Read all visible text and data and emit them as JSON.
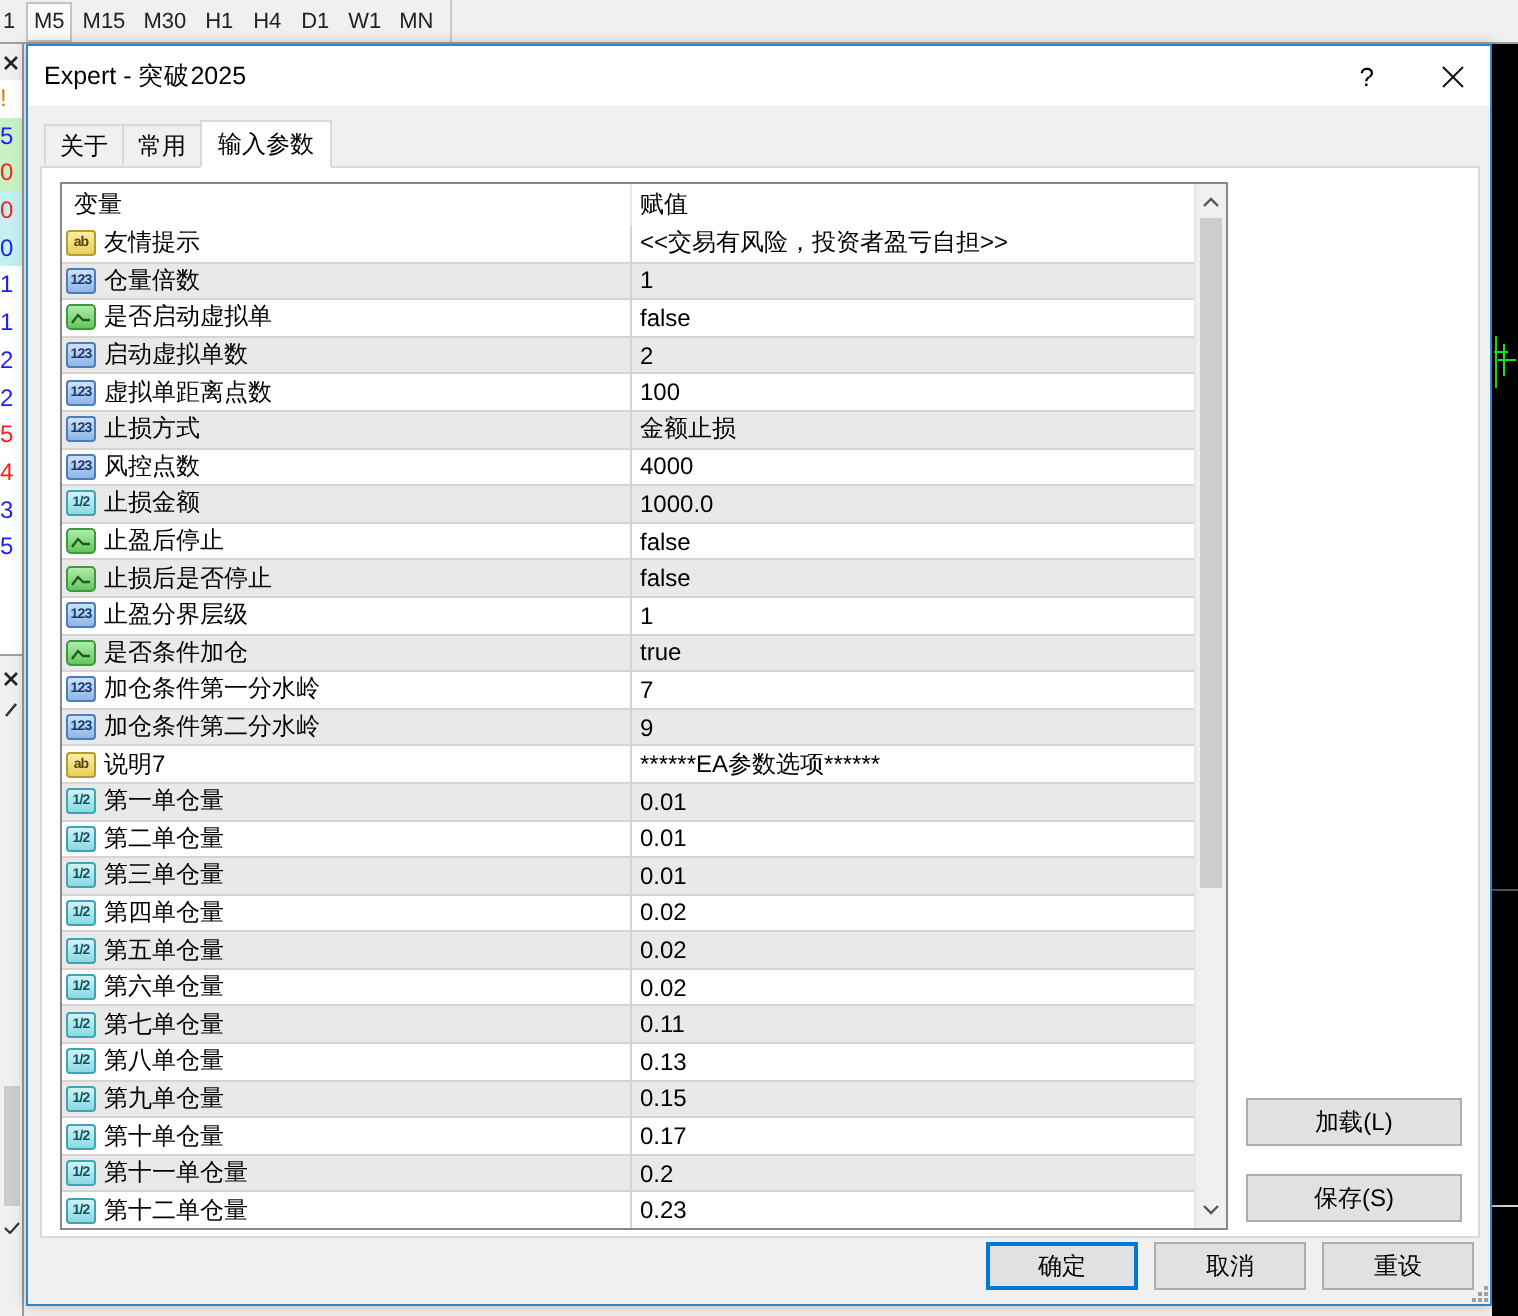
{
  "toolbar": {
    "timeframes": [
      {
        "label": "1",
        "selected": false
      },
      {
        "label": "M5",
        "selected": true
      },
      {
        "label": "M15",
        "selected": false
      },
      {
        "label": "M30",
        "selected": false
      },
      {
        "label": "H1",
        "selected": false
      },
      {
        "label": "H4",
        "selected": false
      },
      {
        "label": "D1",
        "selected": false
      },
      {
        "label": "W1",
        "selected": false
      },
      {
        "label": "MN",
        "selected": false
      }
    ]
  },
  "market_watch": [
    {
      "text": "!",
      "color": "#e07b00",
      "kind": "plain"
    },
    {
      "text": "5",
      "color": "#1c1cff",
      "kind": "green"
    },
    {
      "text": "0",
      "color": "#ff1c1c",
      "kind": "green"
    },
    {
      "text": "0",
      "color": "#ff1c1c",
      "kind": "cyan"
    },
    {
      "text": "0",
      "color": "#1c1cff",
      "kind": "cyan"
    },
    {
      "text": "1",
      "color": "#1c1cff",
      "kind": "plain"
    },
    {
      "text": "1",
      "color": "#1c1cff",
      "kind": "plain"
    },
    {
      "text": "2",
      "color": "#1c1cff",
      "kind": "plain"
    },
    {
      "text": "2",
      "color": "#1c1cff",
      "kind": "plain"
    },
    {
      "text": "5",
      "color": "#ff1c1c",
      "kind": "plain"
    },
    {
      "text": "4",
      "color": "#ff1c1c",
      "kind": "plain"
    },
    {
      "text": "3",
      "color": "#1c1cff",
      "kind": "plain"
    },
    {
      "text": "5",
      "color": "#1c1cff",
      "kind": "plain"
    }
  ],
  "dialog": {
    "title": "Expert - 突破2025",
    "help": "?",
    "tabs": [
      {
        "label": "关于",
        "selected": false
      },
      {
        "label": "常用",
        "selected": false
      },
      {
        "label": "输入参数",
        "selected": true
      }
    ],
    "table": {
      "columns": [
        "变量",
        "赋值"
      ],
      "rows": [
        {
          "kind": "string",
          "badge": "ab",
          "name": "友情提示",
          "value": "<<交易有风险，投资者盈亏自担>>"
        },
        {
          "kind": "int",
          "badge": "123",
          "name": "仓量倍数",
          "value": "1"
        },
        {
          "kind": "bool",
          "name": "是否启动虚拟单",
          "value": "false"
        },
        {
          "kind": "int",
          "badge": "123",
          "name": "启动虚拟单数",
          "value": "2"
        },
        {
          "kind": "int",
          "badge": "123",
          "name": "虚拟单距离点数",
          "value": "100"
        },
        {
          "kind": "int",
          "badge": "123",
          "name": "止损方式",
          "value": "金额止损"
        },
        {
          "kind": "int",
          "badge": "123",
          "name": "风控点数",
          "value": "4000"
        },
        {
          "kind": "double",
          "badge": "1/2",
          "name": "止损金额",
          "value": "1000.0"
        },
        {
          "kind": "bool",
          "name": "止盈后停止",
          "value": "false"
        },
        {
          "kind": "bool",
          "name": "止损后是否停止",
          "value": "false"
        },
        {
          "kind": "int",
          "badge": "123",
          "name": "止盈分界层级",
          "value": "1"
        },
        {
          "kind": "bool",
          "name": "是否条件加仓",
          "value": "true"
        },
        {
          "kind": "int",
          "badge": "123",
          "name": "加仓条件第一分水岭",
          "value": "7"
        },
        {
          "kind": "int",
          "badge": "123",
          "name": "加仓条件第二分水岭",
          "value": "9"
        },
        {
          "kind": "string",
          "badge": "ab",
          "name": "说明7",
          "value": "******EA参数选项******"
        },
        {
          "kind": "double",
          "badge": "1/2",
          "name": "第一单仓量",
          "value": "0.01"
        },
        {
          "kind": "double",
          "badge": "1/2",
          "name": "第二单仓量",
          "value": "0.01"
        },
        {
          "kind": "double",
          "badge": "1/2",
          "name": "第三单仓量",
          "value": "0.01"
        },
        {
          "kind": "double",
          "badge": "1/2",
          "name": "第四单仓量",
          "value": "0.02"
        },
        {
          "kind": "double",
          "badge": "1/2",
          "name": "第五单仓量",
          "value": "0.02"
        },
        {
          "kind": "double",
          "badge": "1/2",
          "name": "第六单仓量",
          "value": "0.02"
        },
        {
          "kind": "double",
          "badge": "1/2",
          "name": "第七单仓量",
          "value": "0.11"
        },
        {
          "kind": "double",
          "badge": "1/2",
          "name": "第八单仓量",
          "value": "0.13"
        },
        {
          "kind": "double",
          "badge": "1/2",
          "name": "第九单仓量",
          "value": "0.15"
        },
        {
          "kind": "double",
          "badge": "1/2",
          "name": "第十单仓量",
          "value": "0.17"
        },
        {
          "kind": "double",
          "badge": "1/2",
          "name": "第十一单仓量",
          "value": "0.2"
        },
        {
          "kind": "double",
          "badge": "1/2",
          "name": "第十二单仓量",
          "value": "0.23"
        }
      ]
    },
    "side_buttons": [
      "加载(L)",
      "保存(S)"
    ],
    "buttons": [
      {
        "label": "确定",
        "default": true
      },
      {
        "label": "取消",
        "default": false
      },
      {
        "label": "重设",
        "default": false
      }
    ]
  }
}
